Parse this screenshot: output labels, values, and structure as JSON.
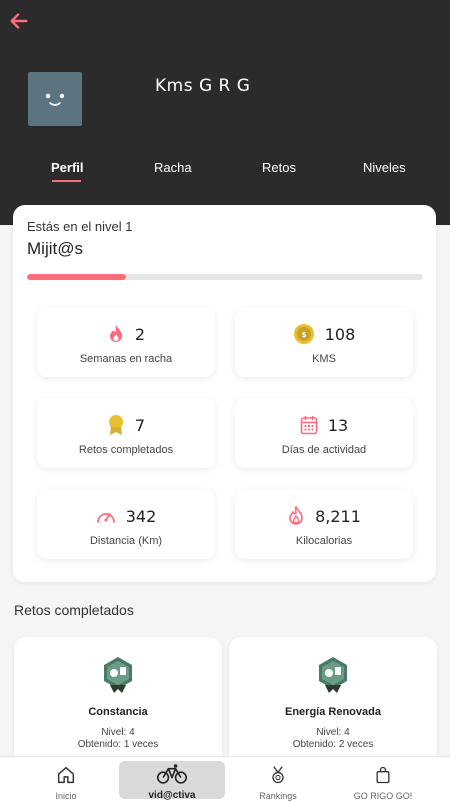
{
  "header": {
    "username": "Kms G R G",
    "back_icon": "arrow-left-icon",
    "colors": {
      "dark": "#2b2b2b",
      "accent": "#ff6b7a",
      "avatar": "#5b7480"
    }
  },
  "tabs": [
    {
      "label": "Perfil",
      "active": true
    },
    {
      "label": "Racha"
    },
    {
      "label": "Retos"
    },
    {
      "label": "Niveles"
    }
  ],
  "level": {
    "title": "Estás en el nivel 1",
    "name": "Mijit@s",
    "progress_percent": 25
  },
  "stats": [
    {
      "value": "2",
      "label": "Semanas en racha",
      "icon": "flame-icon",
      "color": "#ff6b7a"
    },
    {
      "value": "108",
      "label": "KMS",
      "icon": "coin-icon",
      "color": "#c9a227"
    },
    {
      "value": "7",
      "label": "Retos completados",
      "icon": "medal-icon",
      "color": "#d4af37"
    },
    {
      "value": "13",
      "label": "Días de actividad",
      "icon": "calendar-icon",
      "color": "#ff6b7a"
    },
    {
      "value": "342",
      "label": "Distancia (Km)",
      "icon": "speedometer-icon",
      "color": "#ff6b7a"
    },
    {
      "value": "8,211",
      "label": "Kilocalorias",
      "icon": "flame-outline-icon",
      "color": "#ff6b7a"
    }
  ],
  "completed_section": {
    "title": "Retos completados",
    "items": [
      {
        "name": "Constancia",
        "level": "Nivel: 4",
        "obtained": "Obtenido: 1 veces",
        "icon": "badge-icon"
      },
      {
        "name": "Energía Renovada",
        "level": "Nivel: 4",
        "obtained": "Obtenido: 2 veces",
        "icon": "badge-icon"
      }
    ]
  },
  "bottom_nav": [
    {
      "label": "Inicio",
      "icon": "home-icon"
    },
    {
      "label": "vid@ctiva",
      "icon": "bike-icon",
      "active": true
    },
    {
      "label": "Rankings",
      "icon": "medal-icon"
    },
    {
      "label": "GO RIGO GO!",
      "icon": "bag-icon"
    }
  ]
}
